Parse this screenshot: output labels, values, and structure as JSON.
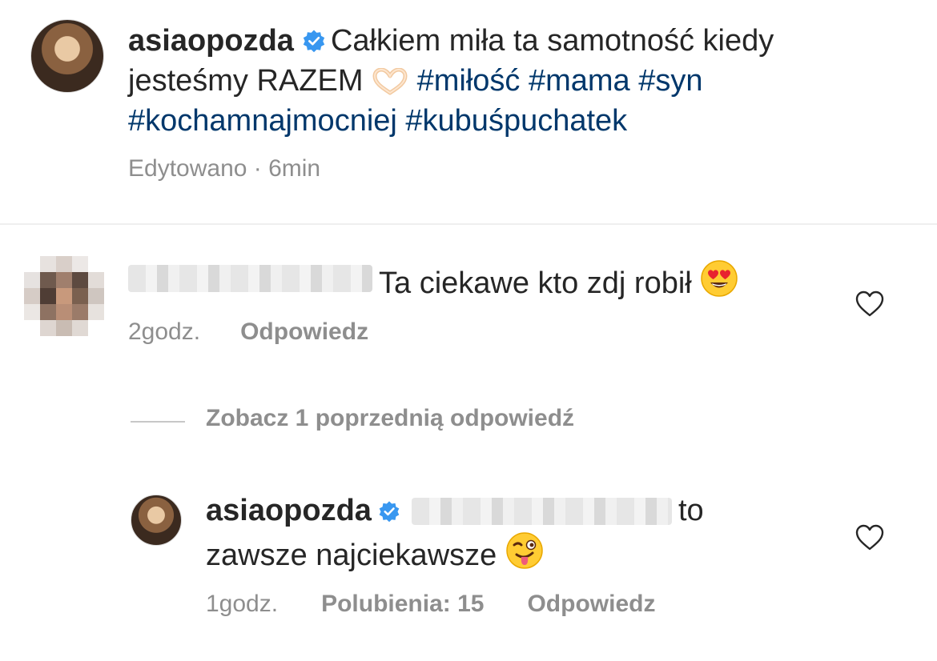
{
  "post": {
    "username": "asiaopozda",
    "caption_text": "Całkiem miła ta samotność kiedy jesteśmy RAZEM",
    "caption_emoji": "heart-hands-emoji",
    "hashtags": [
      "#miłość",
      "#mama",
      "#syn",
      "#kochamnajmocniej",
      "#kubuśpuchatek"
    ],
    "edited_label": "Edytowano · 6min"
  },
  "comment": {
    "text": "Ta ciekawe kto zdj robił",
    "emoji": "heart-eyes-emoji",
    "time": "2godz.",
    "reply_label": "Odpowiedz"
  },
  "view_replies": "Zobacz 1 poprzednią odpowiedź",
  "reply": {
    "username": "asiaopozda",
    "text_part1": "to",
    "text_part2": "zawsze najciekawsze",
    "emoji": "winking-tongue-emoji",
    "time": "1godz.",
    "likes": "Polubienia: 15",
    "reply_label": "Odpowiedz"
  },
  "colors": {
    "text": "#262626",
    "meta": "#8e8e8e",
    "hashtag": "#00376b",
    "verified": "#3897f0"
  }
}
